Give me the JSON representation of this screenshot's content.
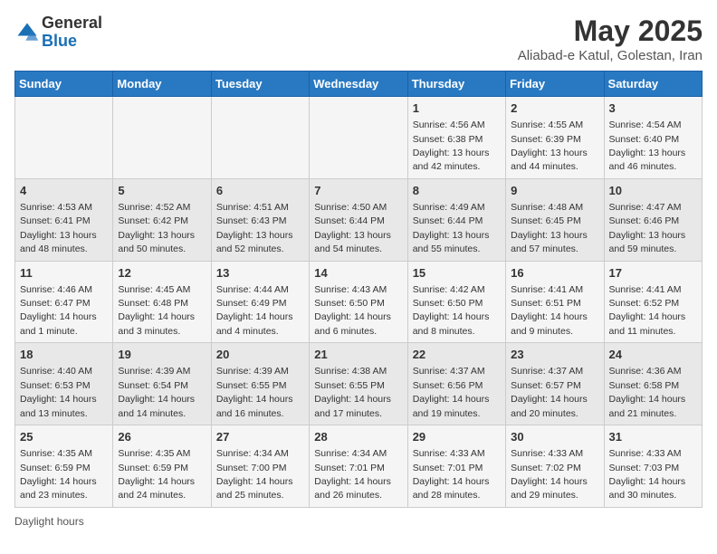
{
  "header": {
    "logo_general": "General",
    "logo_blue": "Blue",
    "title": "May 2025",
    "subtitle": "Aliabad-e Katul, Golestan, Iran"
  },
  "days_of_week": [
    "Sunday",
    "Monday",
    "Tuesday",
    "Wednesday",
    "Thursday",
    "Friday",
    "Saturday"
  ],
  "weeks": [
    [
      {
        "day": "",
        "info": ""
      },
      {
        "day": "",
        "info": ""
      },
      {
        "day": "",
        "info": ""
      },
      {
        "day": "",
        "info": ""
      },
      {
        "day": "1",
        "info": "Sunrise: 4:56 AM\nSunset: 6:38 PM\nDaylight: 13 hours and 42 minutes."
      },
      {
        "day": "2",
        "info": "Sunrise: 4:55 AM\nSunset: 6:39 PM\nDaylight: 13 hours and 44 minutes."
      },
      {
        "day": "3",
        "info": "Sunrise: 4:54 AM\nSunset: 6:40 PM\nDaylight: 13 hours and 46 minutes."
      }
    ],
    [
      {
        "day": "4",
        "info": "Sunrise: 4:53 AM\nSunset: 6:41 PM\nDaylight: 13 hours and 48 minutes."
      },
      {
        "day": "5",
        "info": "Sunrise: 4:52 AM\nSunset: 6:42 PM\nDaylight: 13 hours and 50 minutes."
      },
      {
        "day": "6",
        "info": "Sunrise: 4:51 AM\nSunset: 6:43 PM\nDaylight: 13 hours and 52 minutes."
      },
      {
        "day": "7",
        "info": "Sunrise: 4:50 AM\nSunset: 6:44 PM\nDaylight: 13 hours and 54 minutes."
      },
      {
        "day": "8",
        "info": "Sunrise: 4:49 AM\nSunset: 6:44 PM\nDaylight: 13 hours and 55 minutes."
      },
      {
        "day": "9",
        "info": "Sunrise: 4:48 AM\nSunset: 6:45 PM\nDaylight: 13 hours and 57 minutes."
      },
      {
        "day": "10",
        "info": "Sunrise: 4:47 AM\nSunset: 6:46 PM\nDaylight: 13 hours and 59 minutes."
      }
    ],
    [
      {
        "day": "11",
        "info": "Sunrise: 4:46 AM\nSunset: 6:47 PM\nDaylight: 14 hours and 1 minute."
      },
      {
        "day": "12",
        "info": "Sunrise: 4:45 AM\nSunset: 6:48 PM\nDaylight: 14 hours and 3 minutes."
      },
      {
        "day": "13",
        "info": "Sunrise: 4:44 AM\nSunset: 6:49 PM\nDaylight: 14 hours and 4 minutes."
      },
      {
        "day": "14",
        "info": "Sunrise: 4:43 AM\nSunset: 6:50 PM\nDaylight: 14 hours and 6 minutes."
      },
      {
        "day": "15",
        "info": "Sunrise: 4:42 AM\nSunset: 6:50 PM\nDaylight: 14 hours and 8 minutes."
      },
      {
        "day": "16",
        "info": "Sunrise: 4:41 AM\nSunset: 6:51 PM\nDaylight: 14 hours and 9 minutes."
      },
      {
        "day": "17",
        "info": "Sunrise: 4:41 AM\nSunset: 6:52 PM\nDaylight: 14 hours and 11 minutes."
      }
    ],
    [
      {
        "day": "18",
        "info": "Sunrise: 4:40 AM\nSunset: 6:53 PM\nDaylight: 14 hours and 13 minutes."
      },
      {
        "day": "19",
        "info": "Sunrise: 4:39 AM\nSunset: 6:54 PM\nDaylight: 14 hours and 14 minutes."
      },
      {
        "day": "20",
        "info": "Sunrise: 4:39 AM\nSunset: 6:55 PM\nDaylight: 14 hours and 16 minutes."
      },
      {
        "day": "21",
        "info": "Sunrise: 4:38 AM\nSunset: 6:55 PM\nDaylight: 14 hours and 17 minutes."
      },
      {
        "day": "22",
        "info": "Sunrise: 4:37 AM\nSunset: 6:56 PM\nDaylight: 14 hours and 19 minutes."
      },
      {
        "day": "23",
        "info": "Sunrise: 4:37 AM\nSunset: 6:57 PM\nDaylight: 14 hours and 20 minutes."
      },
      {
        "day": "24",
        "info": "Sunrise: 4:36 AM\nSunset: 6:58 PM\nDaylight: 14 hours and 21 minutes."
      }
    ],
    [
      {
        "day": "25",
        "info": "Sunrise: 4:35 AM\nSunset: 6:59 PM\nDaylight: 14 hours and 23 minutes."
      },
      {
        "day": "26",
        "info": "Sunrise: 4:35 AM\nSunset: 6:59 PM\nDaylight: 14 hours and 24 minutes."
      },
      {
        "day": "27",
        "info": "Sunrise: 4:34 AM\nSunset: 7:00 PM\nDaylight: 14 hours and 25 minutes."
      },
      {
        "day": "28",
        "info": "Sunrise: 4:34 AM\nSunset: 7:01 PM\nDaylight: 14 hours and 26 minutes."
      },
      {
        "day": "29",
        "info": "Sunrise: 4:33 AM\nSunset: 7:01 PM\nDaylight: 14 hours and 28 minutes."
      },
      {
        "day": "30",
        "info": "Sunrise: 4:33 AM\nSunset: 7:02 PM\nDaylight: 14 hours and 29 minutes."
      },
      {
        "day": "31",
        "info": "Sunrise: 4:33 AM\nSunset: 7:03 PM\nDaylight: 14 hours and 30 minutes."
      }
    ]
  ],
  "legend": {
    "daylight_hours": "Daylight hours"
  }
}
